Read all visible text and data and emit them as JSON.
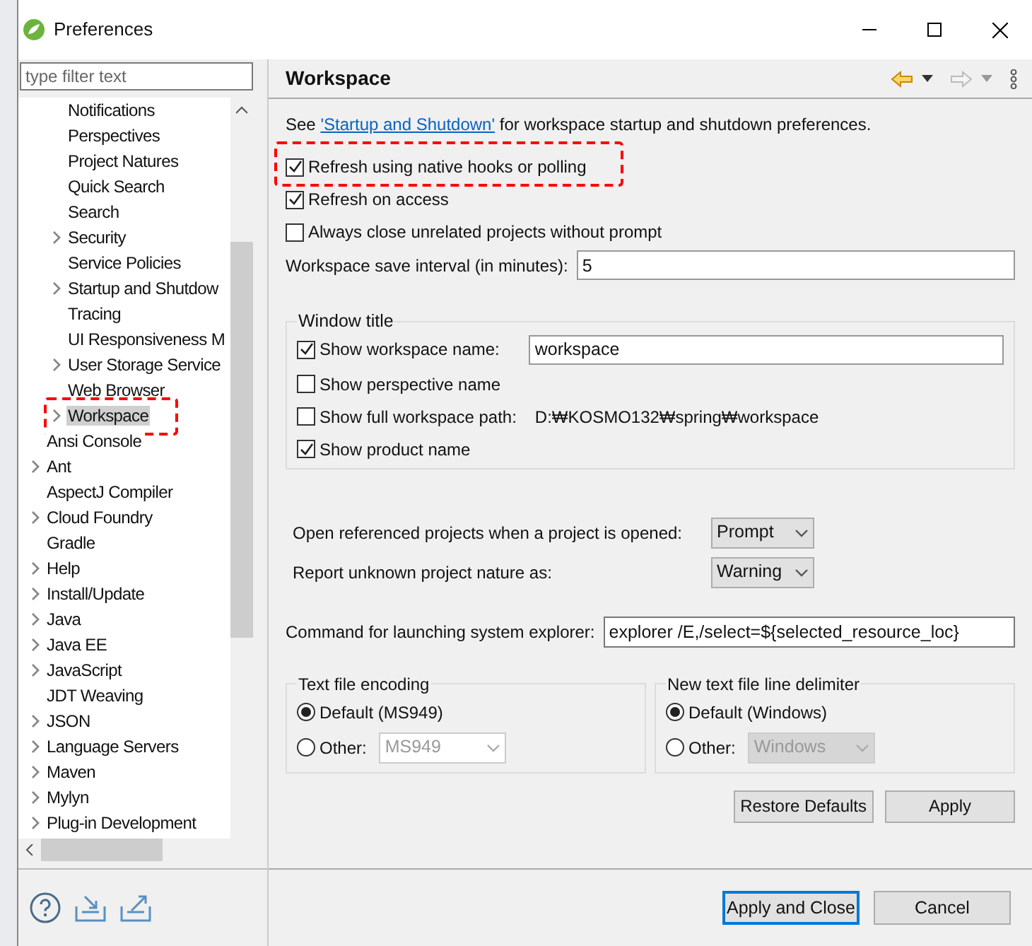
{
  "window": {
    "title": "Preferences"
  },
  "filter": {
    "placeholder": "type filter text"
  },
  "tree": [
    {
      "children": [
        {
          "label": "Notifications",
          "expandable": false,
          "selected": false,
          "highlighted": false
        },
        {
          "label": "Perspectives",
          "expandable": false,
          "selected": false,
          "highlighted": false
        },
        {
          "label": "Project Natures",
          "expandable": false,
          "selected": false,
          "highlighted": false
        },
        {
          "label": "Quick Search",
          "expandable": false,
          "selected": false,
          "highlighted": false
        },
        {
          "label": "Search",
          "expandable": false,
          "selected": false,
          "highlighted": false
        },
        {
          "label": "Security",
          "expandable": true,
          "selected": false,
          "highlighted": false
        },
        {
          "label": "Service Policies",
          "expandable": false,
          "selected": false,
          "highlighted": false
        },
        {
          "label": "Startup and Shutdow",
          "expandable": true,
          "selected": false,
          "highlighted": false
        },
        {
          "label": "Tracing",
          "expandable": false,
          "selected": false,
          "highlighted": false
        },
        {
          "label": "UI Responsiveness M",
          "expandable": false,
          "selected": false,
          "highlighted": false
        },
        {
          "label": "User Storage Service",
          "expandable": true,
          "selected": false,
          "highlighted": false
        },
        {
          "label": "Web Browser",
          "expandable": false,
          "selected": false,
          "highlighted": false
        },
        {
          "label": "Workspace",
          "expandable": true,
          "selected": true,
          "highlighted": true
        }
      ]
    },
    {
      "label": "Ansi Console",
      "expandable": false,
      "selected": false,
      "highlighted": false
    },
    {
      "label": "Ant",
      "expandable": true,
      "selected": false,
      "highlighted": false
    },
    {
      "label": "AspectJ Compiler",
      "expandable": false,
      "selected": false,
      "highlighted": false
    },
    {
      "label": "Cloud Foundry",
      "expandable": true,
      "selected": false,
      "highlighted": false
    },
    {
      "label": "Gradle",
      "expandable": false,
      "selected": false,
      "highlighted": false
    },
    {
      "label": "Help",
      "expandable": true,
      "selected": false,
      "highlighted": false
    },
    {
      "label": "Install/Update",
      "expandable": true,
      "selected": false,
      "highlighted": false
    },
    {
      "label": "Java",
      "expandable": true,
      "selected": false,
      "highlighted": false
    },
    {
      "label": "Java EE",
      "expandable": true,
      "selected": false,
      "highlighted": false
    },
    {
      "label": "JavaScript",
      "expandable": true,
      "selected": false,
      "highlighted": false
    },
    {
      "label": "JDT Weaving",
      "expandable": false,
      "selected": false,
      "highlighted": false
    },
    {
      "label": "JSON",
      "expandable": true,
      "selected": false,
      "highlighted": false
    },
    {
      "label": "Language Servers",
      "expandable": true,
      "selected": false,
      "highlighted": false
    },
    {
      "label": "Maven",
      "expandable": true,
      "selected": false,
      "highlighted": false
    },
    {
      "label": "Mylyn",
      "expandable": true,
      "selected": false,
      "highlighted": false
    },
    {
      "label": "Plug-in Development",
      "expandable": true,
      "selected": false,
      "highlighted": false
    }
  ],
  "page": {
    "title": "Workspace",
    "intro": {
      "before": "See ",
      "link": "'Startup and Shutdown'",
      "after": " for workspace startup and shutdown preferences."
    },
    "options": [
      {
        "label": "Refresh using native hooks or polling",
        "checked": true,
        "highlighted": true
      },
      {
        "label": "Refresh on access",
        "checked": true,
        "highlighted": false
      },
      {
        "label": "Always close unrelated projects without prompt",
        "checked": false,
        "highlighted": false
      }
    ],
    "save_interval": {
      "label": "Workspace save interval (in minutes):",
      "value": "5"
    },
    "window_title": {
      "title": "Window title",
      "options": [
        {
          "kind": "input",
          "label": "Show workspace name:",
          "checked": true,
          "value": "workspace"
        },
        {
          "kind": "plain",
          "label": "Show perspective name",
          "checked": false
        },
        {
          "kind": "path",
          "label": "Show full workspace path:",
          "checked": false,
          "value": "D:₩KOSMO132₩spring₩workspace"
        },
        {
          "kind": "plain",
          "label": "Show product name",
          "checked": true
        }
      ]
    },
    "selects": [
      {
        "label": "Open referenced projects when a project is opened:",
        "value": "Prompt"
      },
      {
        "label": "Report unknown project nature as:",
        "value": "Warning"
      }
    ],
    "explorer": {
      "label": "Command for launching system explorer:",
      "value": "explorer /E,/select=${selected_resource_loc}"
    },
    "groups": [
      {
        "title": "Text file encoding",
        "options": [
          {
            "label": "Default (MS949)",
            "selected": true
          },
          {
            "label": "Other:",
            "selected": false,
            "value": "MS949"
          }
        ]
      },
      {
        "title": "New text file line delimiter",
        "options": [
          {
            "label": "Default (Windows)",
            "selected": true
          },
          {
            "label": "Other:",
            "selected": false,
            "value": "Windows"
          }
        ]
      }
    ],
    "buttons": [
      "Restore Defaults",
      "Apply"
    ]
  },
  "footer": {
    "buttons": [
      {
        "label": "Apply and Close",
        "default": true
      },
      {
        "label": "Cancel",
        "default": false
      }
    ]
  }
}
